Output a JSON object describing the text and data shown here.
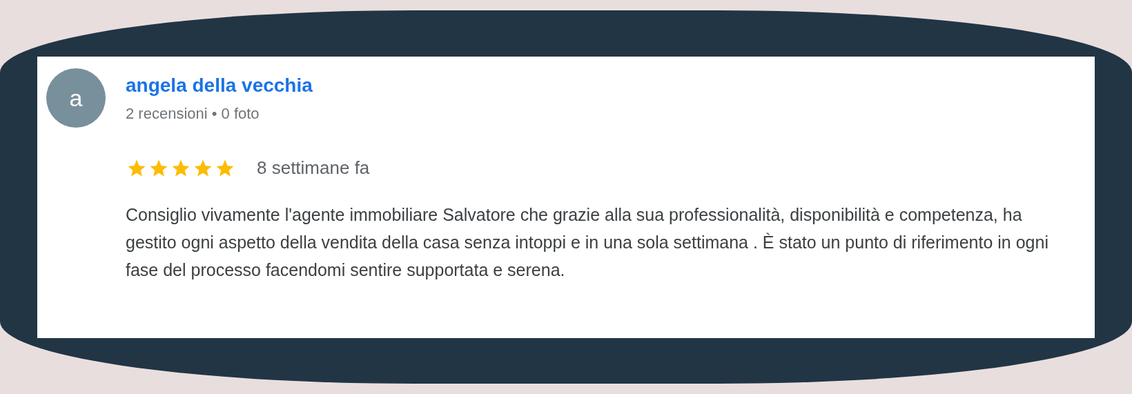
{
  "review": {
    "avatar_letter": "a",
    "author": "angela della vecchia",
    "meta": "2 recensioni • 0 foto",
    "stars": 5,
    "time": "8 settimane fa",
    "text": "Consiglio vivamente l'agente immobiliare Salvatore che grazie alla sua professionalità, disponibilità e competenza, ha gestito ogni aspetto della vendita della casa senza intoppi e in una sola settimana . È stato un punto di riferimento in ogni fase del processo facendomi sentire supportata e serena."
  }
}
